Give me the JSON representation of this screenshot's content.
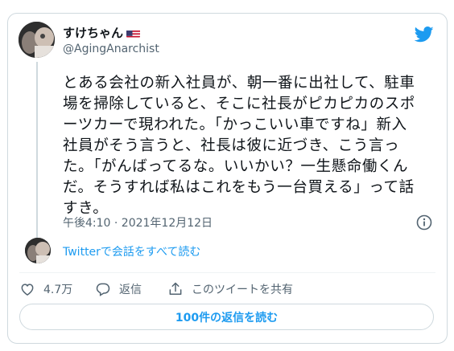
{
  "tweet": {
    "author": {
      "display_name": "すけちゃん",
      "handle": "@AgingAnarchist",
      "flag_icon": "us-flag-icon"
    },
    "text": "とある会社の新入社員が、朝一番に出社して、駐車\n場を掃除していると、そこに社長がピカピカのスポ\nーツカーで現われた。「かっこいい車ですね」新入\n社員がそう言うと、社長は彼に近づき、こう言っ\nた。「がんばってるな。いいかい？一生懸命働くん\nだ。そうすれば私はこれをもう一台買える」って話\nすき。",
    "timestamp": "午後4:10 · 2021年12月12日",
    "read_conversation": "Twitterで会話をすべて読む",
    "actions": {
      "likes": "4.7万",
      "reply_label": "返信",
      "share_label": "このツイートを共有"
    },
    "read_replies_button": "100件の返信を読む"
  },
  "colors": {
    "accent": "#1d9bf0",
    "text": "#0f1419",
    "secondary": "#536471",
    "border": "#cfd9de"
  },
  "icons": [
    "twitter-bird-icon",
    "info-icon",
    "heart-icon",
    "reply-bubble-icon",
    "share-icon"
  ]
}
